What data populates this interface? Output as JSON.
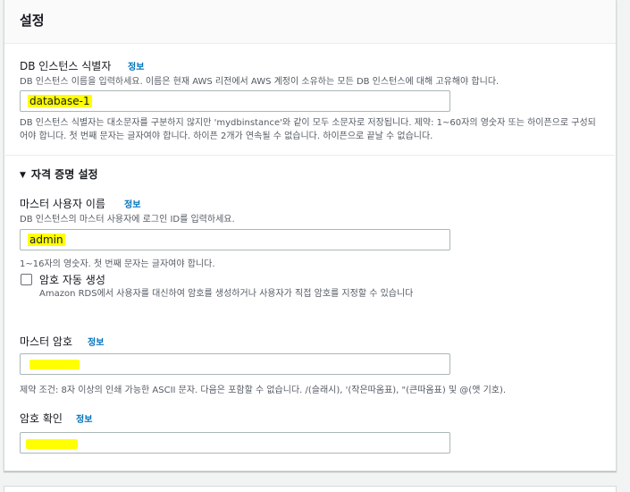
{
  "panel": {
    "title": "설정"
  },
  "db_identifier": {
    "label": "DB 인스턴스 식별자",
    "info": "정보",
    "description": "DB 인스턴스 이름을 입력하세요. 이름은 현재 AWS 리전에서 AWS 계정이 소유하는 모든 DB 인스턴스에 대해 고유해야 합니다.",
    "value": "database-1",
    "constraint": "DB 인스턴스 식별자는 대소문자를 구분하지 않지만 'mydbinstance'와 같이 모두 소문자로 저장됩니다. 제약: 1~60자의 영숫자 또는 하이픈으로 구성되어야 합니다. 첫 번째 문자는 글자여야 합니다. 하이픈 2개가 연속될 수 없습니다. 하이픈으로 끝날 수 없습니다."
  },
  "credentials": {
    "section_title": "자격 증명 설정",
    "master_username": {
      "label": "마스터 사용자 이름",
      "info": "정보",
      "description": "DB 인스턴스의 마스터 사용자에 로그인 ID를 입력하세요.",
      "value": "admin",
      "constraint": "1~16자의 영숫자. 첫 번째 문자는 글자여야 합니다."
    },
    "auto_password": {
      "label": "암호 자동 생성",
      "description": "Amazon RDS에서 사용자를 대신하여 암호를 생성하거나 사용자가 직접 암호를 지정할 수 있습니다",
      "checked": false
    },
    "master_password": {
      "label": "마스터 암호",
      "info": "정보",
      "constraint": "제약 조건: 8자 이상의 인쇄 가능한 ASCII 문자. 다음은 포함할 수 없습니다. /(슬래시), '(작은따옴표), \"(큰따옴표) 및 @(앳 기호)."
    },
    "confirm_password": {
      "label": "암호 확인",
      "info": "정보"
    }
  },
  "colors": {
    "link": "#0073bb",
    "highlight": "#ffff00",
    "input_border": "#aab7b8"
  }
}
